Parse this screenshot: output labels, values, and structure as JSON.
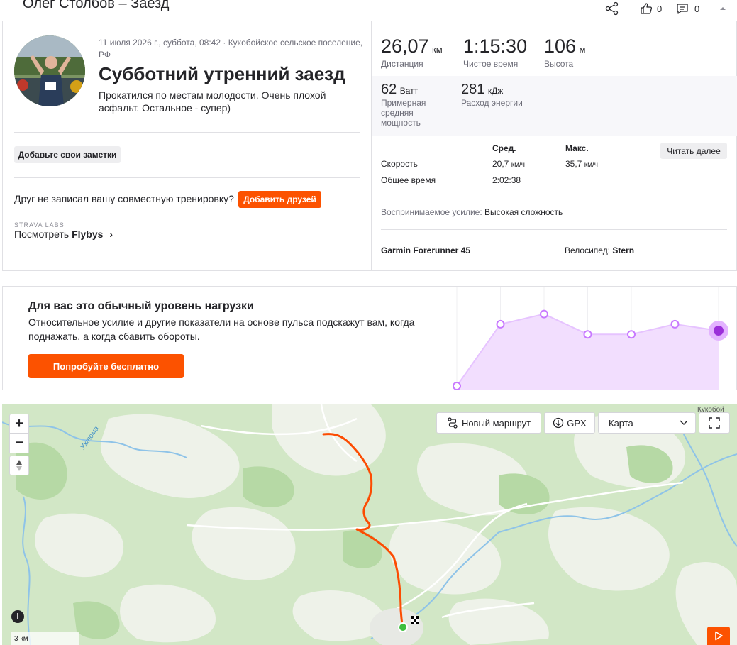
{
  "header": {
    "title": "Олег Столбов – Заезд",
    "kudos_count": "0",
    "comments_count": "0"
  },
  "activity": {
    "meta": "11 июля 2026 г., суббота, 08:42 · Кукобойское сельское поселение, РФ",
    "name": "Субботний утренний заезд",
    "description": "Прокатился по местам молодости. Очень плохой асфальт. Остальное - супер)",
    "add_notes_label": "Добавьте свои заметки",
    "friend_question": "Друг не записал вашу совместную тренировку?",
    "add_friends_label": "Добавить друзей",
    "labs_label": "STRAVA LABS",
    "flybys_prefix": "Посмотреть ",
    "flybys_name": "Flybys",
    "flybys_chevron": "›"
  },
  "stats": {
    "distance": {
      "value": "26,07",
      "unit": "км",
      "label": "Дистанция"
    },
    "moving_time": {
      "value": "1:15:30",
      "unit": "",
      "label": "Чистое время"
    },
    "elevation": {
      "value": "106",
      "unit": "м",
      "label": "Высота"
    },
    "power": {
      "value": "62",
      "unit": "Ватт",
      "label": "Примерная средняя мощность"
    },
    "energy": {
      "value": "281",
      "unit": "кДж",
      "label": "Расход энергии"
    },
    "table": {
      "col_avg": "Сред.",
      "col_max": "Макс.",
      "read_more_label": "Читать далее",
      "speed_label": "Скорость",
      "speed_avg": "20,7",
      "speed_max": "35,7",
      "speed_unit": "км/ч",
      "elapsed_label": "Общее время",
      "elapsed_value": "2:02:38"
    },
    "perceived_label": "Воспринимаемое усилие:",
    "perceived_value": "Высокая сложность",
    "device": "Garmin Forerunner 45",
    "bike_label": "Велосипед:",
    "bike_value": "Stern"
  },
  "effort": {
    "title": "Для вас это обычный уровень нагрузки",
    "text": "Относительное усилие и другие показатели на основе пульса подскажут вам, когда поднажать, а когда сбавить обороты.",
    "cta_label": "Попробуйте бесплатно",
    "trend_levels": [
      0.0,
      0.67,
      0.78,
      0.56,
      0.56,
      0.67,
      0.6
    ]
  },
  "map": {
    "new_route_label": "Новый маршрут",
    "gpx_label": "GPX",
    "map_type_selected": "Карта",
    "zoom_in": "+",
    "zoom_out": "−",
    "scale_label": "3 км",
    "river_label": "Ухтома",
    "place_label": "Кукобой",
    "info_label": "i"
  },
  "colors": {
    "brand": "#fc5200",
    "effort_purple": "#c879ff",
    "route": "#fc4c02",
    "start": "#3fbf3f"
  }
}
